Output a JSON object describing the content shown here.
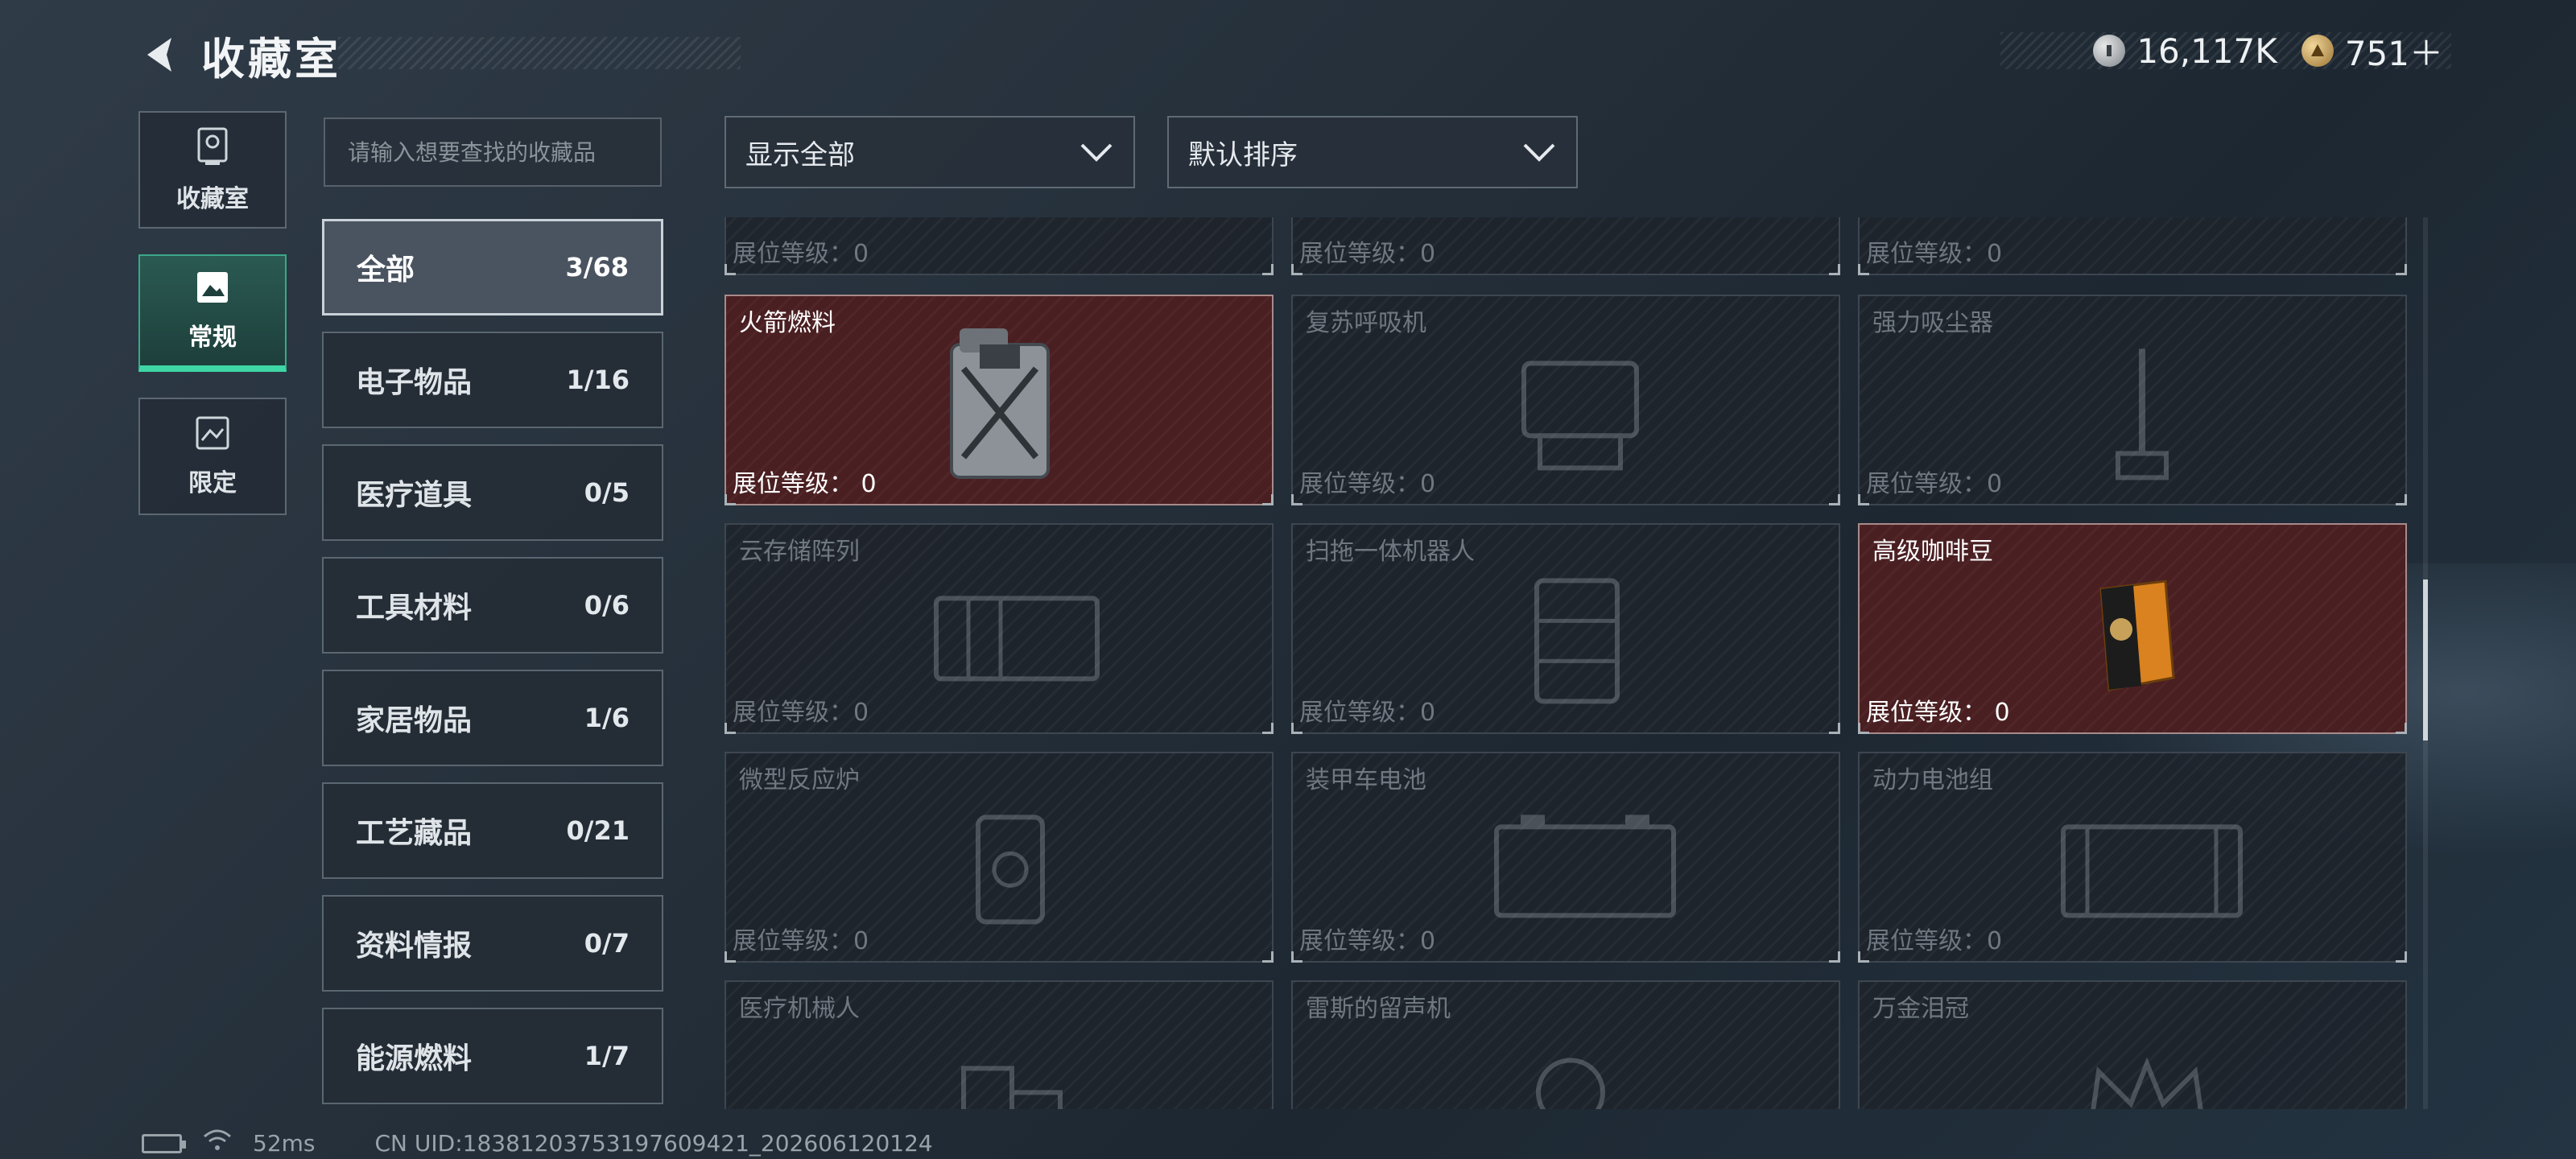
{
  "header": {
    "title": "收藏室"
  },
  "currency": {
    "silver": "16,117K",
    "gold": "751＋"
  },
  "nav": [
    {
      "label": "收藏室",
      "icon": "trophy-icon"
    },
    {
      "label": "常规",
      "icon": "picture-icon",
      "active": true
    },
    {
      "label": "限定",
      "icon": "image-frame-icon"
    }
  ],
  "search": {
    "placeholder": "请输入想要查找的收藏品"
  },
  "filters": {
    "show_label": "显示全部",
    "sort_label": "默认排序"
  },
  "categories": [
    {
      "name": "全部",
      "count": "3/68",
      "active": true
    },
    {
      "name": "电子物品",
      "count": "1/16"
    },
    {
      "name": "医疗道具",
      "count": "0/5"
    },
    {
      "name": "工具材料",
      "count": "0/6"
    },
    {
      "name": "家居物品",
      "count": "1/6"
    },
    {
      "name": "工艺藏品",
      "count": "0/21"
    },
    {
      "name": "资料情报",
      "count": "0/7"
    },
    {
      "name": "能源燃料",
      "count": "1/7"
    }
  ],
  "level_label": "展位等级：0",
  "level_label_owned": "展位等级： 0",
  "items": [
    {
      "name": "",
      "owned": false
    },
    {
      "name": "",
      "owned": false
    },
    {
      "name": "",
      "owned": false
    },
    {
      "name": "火箭燃料",
      "owned": true
    },
    {
      "name": "复苏呼吸机",
      "owned": false
    },
    {
      "name": "强力吸尘器",
      "owned": false
    },
    {
      "name": "云存储阵列",
      "owned": false
    },
    {
      "name": "扫拖一体机器人",
      "owned": false
    },
    {
      "name": "高级咖啡豆",
      "owned": true
    },
    {
      "name": "微型反应炉",
      "owned": false
    },
    {
      "name": "装甲车电池",
      "owned": false
    },
    {
      "name": "动力电池组",
      "owned": false
    },
    {
      "name": "医疗机械人",
      "owned": false
    },
    {
      "name": "雷斯的留声机",
      "owned": false
    },
    {
      "name": "万金泪冠",
      "owned": false
    }
  ],
  "status": {
    "ping": "52ms",
    "uid": "CN UID:18381203753197609421_202606120124"
  },
  "colors": {
    "accent": "#3fd6a6",
    "owned_bg": "#4a1f22",
    "locked_bg": "#1e242b"
  }
}
